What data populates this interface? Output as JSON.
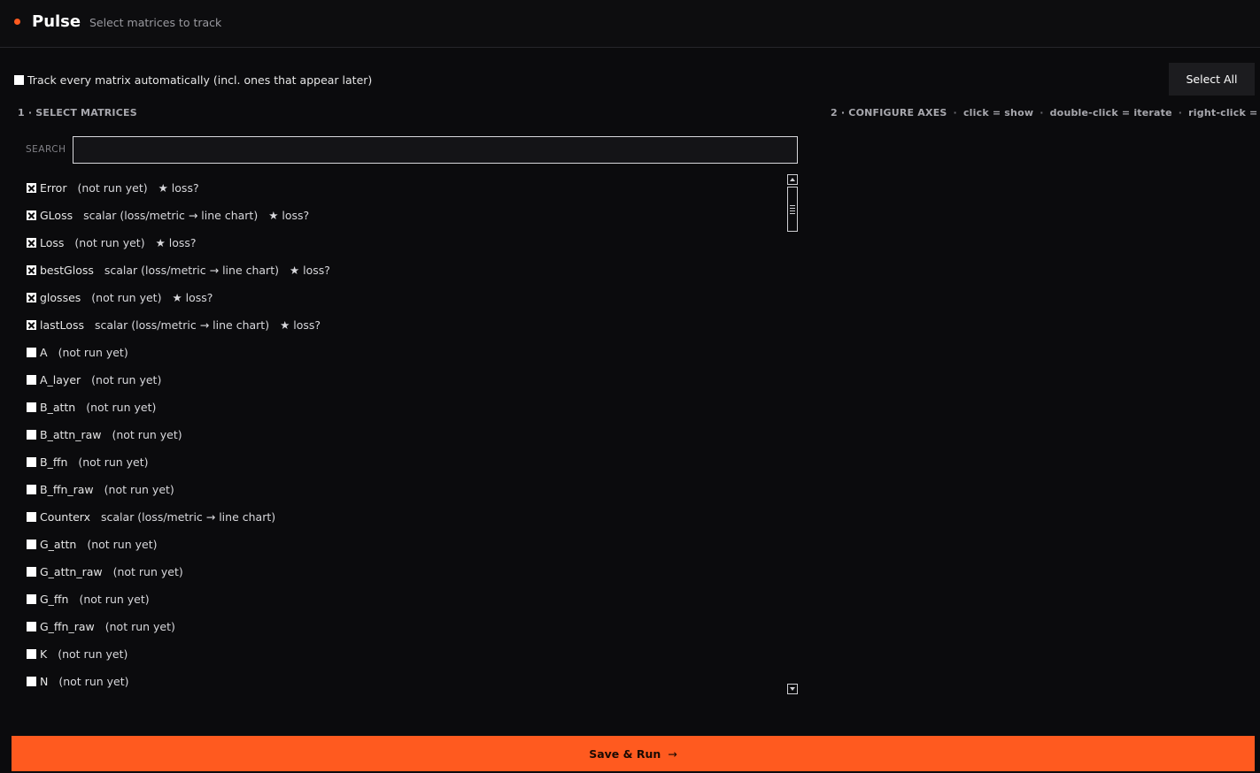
{
  "header": {
    "title": "Pulse",
    "subtitle": "Select matrices to track",
    "accent_color": "#ff5a1f"
  },
  "track_all": {
    "label": "Track every matrix automatically (incl. ones that appear later)",
    "checked": false
  },
  "select_all_label": "Select All",
  "section1_title": "1 · SELECT MATRICES",
  "section2": {
    "title": "2 · CONFIGURE AXES",
    "hints": [
      "click = show",
      "double-click = iterate",
      "right-click = reset"
    ]
  },
  "search": {
    "label": "SEARCH",
    "value": "",
    "placeholder": ""
  },
  "matrices": [
    {
      "name": "Error",
      "status": "(not run yet)",
      "loss": "★ loss?",
      "checked": true
    },
    {
      "name": "GLoss",
      "status": "scalar (loss/metric → line chart)",
      "loss": "★ loss?",
      "checked": true
    },
    {
      "name": "Loss",
      "status": "(not run yet)",
      "loss": "★ loss?",
      "checked": true
    },
    {
      "name": "bestGloss",
      "status": "scalar (loss/metric → line chart)",
      "loss": "★ loss?",
      "checked": true
    },
    {
      "name": "glosses",
      "status": "(not run yet)",
      "loss": "★ loss?",
      "checked": true
    },
    {
      "name": "lastLoss",
      "status": "scalar (loss/metric → line chart)",
      "loss": "★ loss?",
      "checked": true
    },
    {
      "name": "A",
      "status": "(not run yet)",
      "loss": "",
      "checked": false
    },
    {
      "name": "A_layer",
      "status": "(not run yet)",
      "loss": "",
      "checked": false
    },
    {
      "name": "B_attn",
      "status": "(not run yet)",
      "loss": "",
      "checked": false
    },
    {
      "name": "B_attn_raw",
      "status": "(not run yet)",
      "loss": "",
      "checked": false
    },
    {
      "name": "B_ffn",
      "status": "(not run yet)",
      "loss": "",
      "checked": false
    },
    {
      "name": "B_ffn_raw",
      "status": "(not run yet)",
      "loss": "",
      "checked": false
    },
    {
      "name": "Counterx",
      "status": "scalar (loss/metric → line chart)",
      "loss": "",
      "checked": false
    },
    {
      "name": "G_attn",
      "status": "(not run yet)",
      "loss": "",
      "checked": false
    },
    {
      "name": "G_attn_raw",
      "status": "(not run yet)",
      "loss": "",
      "checked": false
    },
    {
      "name": "G_ffn",
      "status": "(not run yet)",
      "loss": "",
      "checked": false
    },
    {
      "name": "G_ffn_raw",
      "status": "(not run yet)",
      "loss": "",
      "checked": false
    },
    {
      "name": "K",
      "status": "(not run yet)",
      "loss": "",
      "checked": false
    },
    {
      "name": "N",
      "status": "(not run yet)",
      "loss": "",
      "checked": false
    }
  ],
  "run_button": {
    "label": "Save & Run",
    "arrow": "→"
  }
}
